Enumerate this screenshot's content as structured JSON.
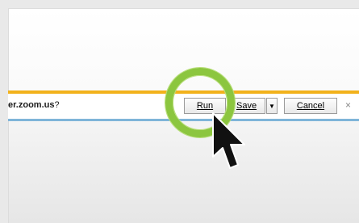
{
  "notification": {
    "prompt_host": "er.zoom.us",
    "prompt_suffix": "?",
    "run_label": "Run",
    "save_label": "Save",
    "cancel_label": "Cancel",
    "close_glyph": "×",
    "dropdown_glyph": "▼"
  },
  "overlay": {
    "highlight_color": "#8cc63f",
    "cursor_icon": "arrow-cursor-icon"
  }
}
